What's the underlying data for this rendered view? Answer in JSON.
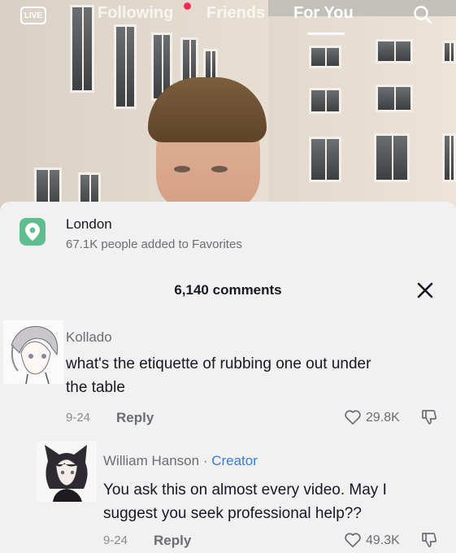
{
  "nav": {
    "live": "LIVE",
    "tabs": [
      {
        "label": "Following"
      },
      {
        "label": "Friends"
      },
      {
        "label": "For You"
      }
    ],
    "accent": "#fe2c55"
  },
  "location": {
    "title": "London",
    "subtitle": "67.1K people added to Favorites",
    "icon_color": "#5fbd90"
  },
  "comments_panel": {
    "header": "6,140 comments",
    "comments": [
      {
        "user": "Kollado",
        "text_line1": "what's the etiquette of rubbing one out under",
        "text_line2": "the table",
        "date": "9-24",
        "reply": "Reply",
        "likes": "29.8K"
      },
      {
        "user": "William Hanson",
        "badge": " · Creator",
        "text_line1": "You ask this on almost every video. May I",
        "text_line2": "suggest you seek professional help??",
        "date": "9-24",
        "reply": "Reply",
        "likes": "49.3K"
      }
    ]
  }
}
